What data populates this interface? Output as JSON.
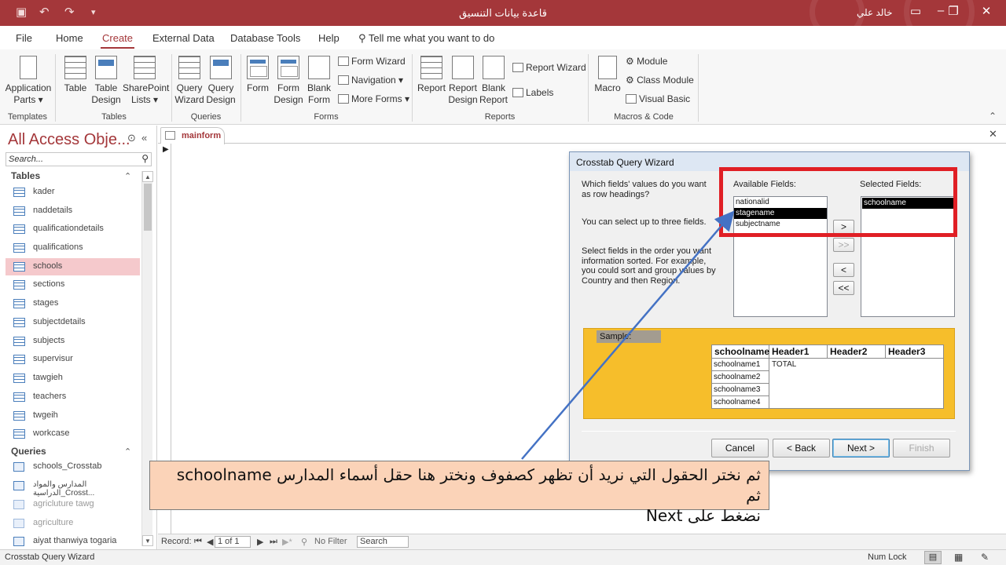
{
  "window": {
    "title": "قاعدة بيانات التنسيق",
    "user": "خالد علي",
    "colors": {
      "accent": "#a4373a",
      "highlight": "#e01f25",
      "callout_bg": "#fbd3b8"
    }
  },
  "menu": {
    "tabs": [
      "File",
      "Home",
      "Create",
      "External Data",
      "Database Tools",
      "Help"
    ],
    "active": "Create",
    "tell_me": "Tell me what you want to do"
  },
  "ribbon": {
    "groups": {
      "templates": "Templates",
      "tables": "Tables",
      "queries": "Queries",
      "forms": "Forms",
      "reports": "Reports",
      "macros": "Macros & Code"
    },
    "buttons": {
      "app_parts_1": "Application",
      "app_parts_2": "Parts ▾",
      "table": "Table",
      "table_design_1": "Table",
      "table_design_2": "Design",
      "sharepoint_1": "SharePoint",
      "sharepoint_2": "Lists ▾",
      "query_wizard_1": "Query",
      "query_wizard_2": "Wizard",
      "query_design_1": "Query",
      "query_design_2": "Design",
      "form": "Form",
      "form_design_1": "Form",
      "form_design_2": "Design",
      "blank_form_1": "Blank",
      "blank_form_2": "Form",
      "form_wizard": "Form Wizard",
      "navigation": "Navigation ▾",
      "more_forms": "More Forms ▾",
      "report": "Report",
      "report_design_1": "Report",
      "report_design_2": "Design",
      "blank_report_1": "Blank",
      "blank_report_2": "Report",
      "report_wizard": "Report Wizard",
      "labels": "Labels",
      "macro": "Macro",
      "module": "Module",
      "class_module": "Class Module",
      "visual_basic": "Visual Basic"
    }
  },
  "nav": {
    "title": "All Access Obje...",
    "search_placeholder": "Search...",
    "groups": {
      "tables": "Tables",
      "queries": "Queries"
    },
    "tables": [
      "kader",
      "naddetails",
      "qualificationdetails",
      "qualifications",
      "schools",
      "sections",
      "stages",
      "subjectdetails",
      "subjects",
      "supervisur",
      "tawgieh",
      "teachers",
      "twgeih",
      "workcase"
    ],
    "selected_table": "schools",
    "queries": [
      "schools_Crosstab",
      "المدارس والمواد الدراسية_Crosst...",
      "agricluture tawg",
      "agriculture",
      "aiyat thanwiya togaria"
    ]
  },
  "document": {
    "tab": "mainform",
    "record": {
      "label": "Record:",
      "current": "1 of 1",
      "filter": "No Filter",
      "search": "Search"
    }
  },
  "status": {
    "left": "Crosstab Query Wizard",
    "num_lock": "Num Lock"
  },
  "wizard": {
    "title": "Crosstab Query Wizard",
    "question": "Which fields' values do you want as row headings?",
    "limit": "You can select up to three fields.",
    "instructions": "Select fields in the order you want information sorted.  For example, you could sort and group values by Country and then Region.",
    "available_label": "Available Fields:",
    "selected_label": "Selected Fields:",
    "available_fields": [
      "nationalid",
      "stagename",
      "subjectname"
    ],
    "available_selected": "stagename",
    "selected_fields": [
      "schoolname"
    ],
    "move_buttons": [
      ">",
      ">>",
      "<",
      "<<"
    ],
    "sample": {
      "label": "Sample:",
      "headers": [
        "schoolname",
        "Header1",
        "Header2",
        "Header3"
      ],
      "rows": [
        "schoolname1",
        "schoolname2",
        "schoolname3",
        "schoolname4"
      ],
      "total": "TOTAL"
    },
    "buttons": {
      "cancel": "Cancel",
      "back": "< Back",
      "next": "Next >",
      "finish": "Finish"
    }
  },
  "callout": {
    "line1": "ثم نختر الحقول التي نريد أن تظهر كصفوف ونختر هنا حقل أسماء المدارس schoolname ثم",
    "line2": "نضغط على Next"
  }
}
